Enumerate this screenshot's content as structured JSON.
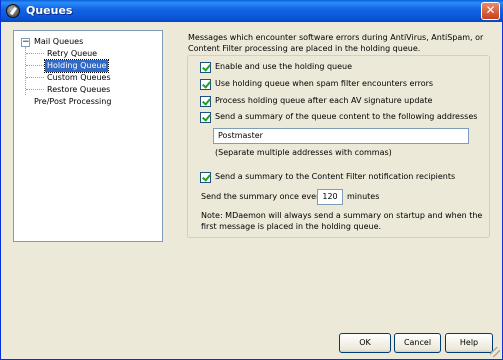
{
  "window": {
    "title": "Queues",
    "close_glyph": "✕"
  },
  "tree": {
    "root_label": "Mail Queues",
    "expander": "−",
    "children": [
      "Retry Queue",
      "Holding Queue",
      "Custom Queues",
      "Restore Queues"
    ],
    "selected": "Holding Queue",
    "sibling_label": "Pre/Post Processing"
  },
  "content": {
    "description": "Messages which encounter software errors during AntiVirus, AntiSpam, or Content Filter processing are placed in the holding queue.",
    "options": [
      {
        "label": "Enable and use the holding queue",
        "checked": true
      },
      {
        "label": "Use holding queue when spam filter encounters errors",
        "checked": true
      },
      {
        "label": "Process holding queue after each AV signature update",
        "checked": true
      },
      {
        "label": "Send a summary of the queue content to the following addresses",
        "checked": true
      }
    ],
    "addresses_value": "Postmaster",
    "addresses_hint": "(Separate multiple addresses with commas)",
    "notify_option": {
      "label": "Send a summary to the Content Filter notification recipients",
      "checked": true
    },
    "interval_prefix": "Send the summary once every",
    "interval_value": "120",
    "interval_suffix": "minutes",
    "note": "Note:  MDaemon will always send a summary on startup and when the first message is placed in the holding queue."
  },
  "buttons": {
    "ok": "OK",
    "cancel": "Cancel",
    "help": "Help"
  },
  "colors": {
    "titlebar": "#0b56d6",
    "selection": "#316ac5",
    "dialog_bg": "#ece9d8"
  },
  "icons": {
    "app": "mdaemon-app-icon",
    "close": "close-icon"
  }
}
